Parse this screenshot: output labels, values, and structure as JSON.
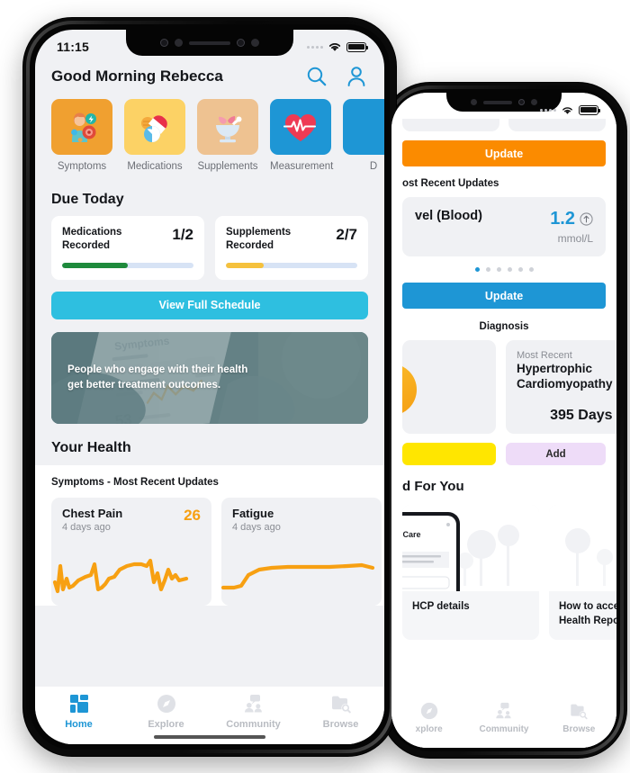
{
  "front_phone": {
    "status": {
      "time": "11:15",
      "wifi_icon": "wifi-icon",
      "battery_icon": "battery-icon"
    },
    "header": {
      "greeting": "Good Morning Rebecca",
      "search_icon": "search-icon",
      "profile_icon": "profile-icon"
    },
    "tiles": [
      {
        "label": "Symptoms",
        "icon": "symptoms-icon",
        "bg": "#F0A030"
      },
      {
        "label": "Medications",
        "icon": "medications-icon",
        "bg": "#FCD265"
      },
      {
        "label": "Supplements",
        "icon": "supplements-icon",
        "bg": "#EEC291"
      },
      {
        "label": "Measurement",
        "icon": "heart-rate-icon",
        "bg": "#1E96D5"
      },
      {
        "label": "D",
        "icon": "cut-off-icon",
        "bg": "#1E96D5"
      }
    ],
    "due_today": {
      "title": "Due Today",
      "cards": [
        {
          "name": "Medications Recorded",
          "fraction": "1/2",
          "percent": 50,
          "color": "#1E8A3C"
        },
        {
          "name": "Supplements Recorded",
          "fraction": "2/7",
          "percent": 29,
          "color": "#F5C13D"
        }
      ],
      "schedule_button": "View Full Schedule",
      "schedule_button_color": "#2EBFE0"
    },
    "banner": {
      "line1": "People who engage with their health",
      "line2": "get better treatment outcomes."
    },
    "your_health": {
      "title": "Your Health",
      "subtitle": "Symptoms - Most Recent Updates",
      "cards": [
        {
          "name": "Chest Pain",
          "ago": "4 days ago",
          "value": "26"
        },
        {
          "name": "Fatigue",
          "ago": "4 days ago",
          "value": ""
        }
      ]
    },
    "tabbar": [
      {
        "label": "Home",
        "icon": "grid-icon",
        "active": true
      },
      {
        "label": "Explore",
        "icon": "compass-icon",
        "active": false
      },
      {
        "label": "Community",
        "icon": "community-icon",
        "active": false
      },
      {
        "label": "Browse",
        "icon": "browse-icon",
        "active": false
      }
    ]
  },
  "back_phone": {
    "status": {
      "wifi_icon": "wifi-icon",
      "battery_icon": "battery-icon"
    },
    "update_button_orange": "Update",
    "update_button_orange_color": "#FB8B00",
    "recent_updates_label": "ost Recent Updates",
    "measurement_card": {
      "title": "vel (Blood)",
      "value": "1.2",
      "trend_icon": "arrow-up-circle-icon",
      "unit": "mmol/L"
    },
    "pager": {
      "count": 6,
      "active_index": 0
    },
    "update_button_blue": "Update",
    "update_button_blue_color": "#1E96D5",
    "diagnosis": {
      "title": "Diagnosis",
      "most_recent_label": "Most Recent",
      "name": "Hypertrophic Cardiomyopathy",
      "days": "395 Days",
      "add_button": "Add",
      "add_button_color": "#EEDCF8",
      "left_button_color": "#FFE600"
    },
    "for_you": {
      "title": "d For You",
      "cards": [
        {
          "caption": "HCP details",
          "icon": "phone-mockup-icon"
        },
        {
          "caption": "How to access and Health Report",
          "icon": "phone-mockup-icon"
        }
      ]
    },
    "tabbar": [
      {
        "label": "xplore",
        "icon": "compass-icon"
      },
      {
        "label": "Community",
        "icon": "community-icon"
      },
      {
        "label": "Browse",
        "icon": "browse-icon"
      }
    ]
  }
}
